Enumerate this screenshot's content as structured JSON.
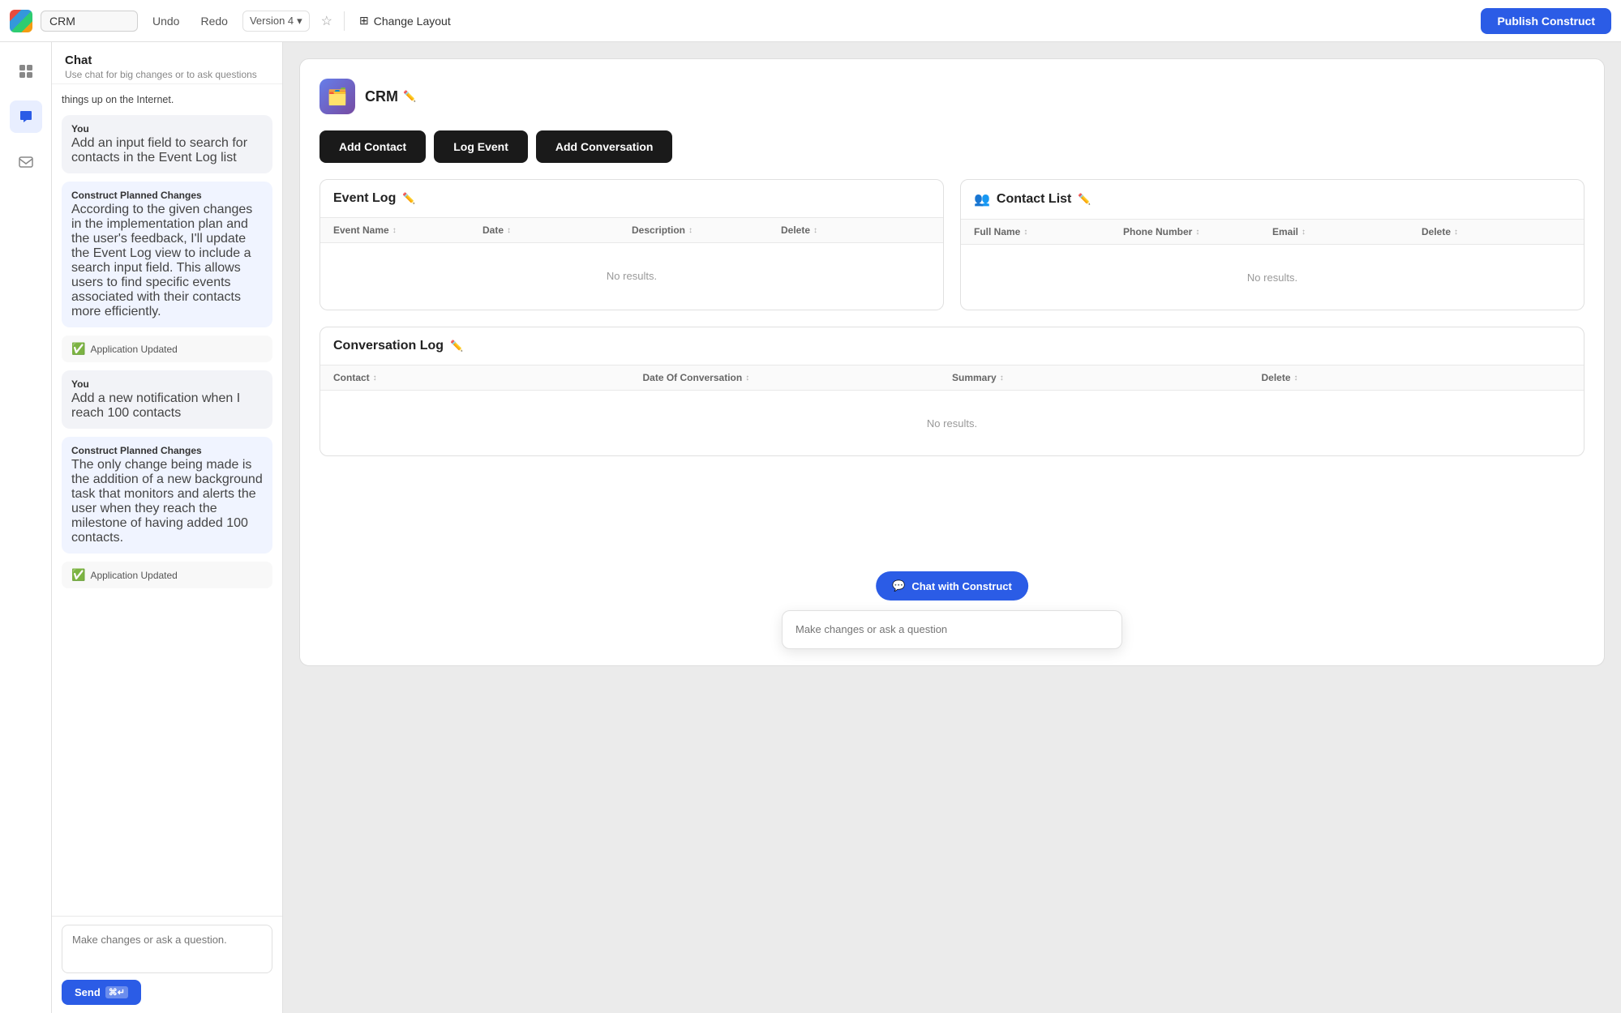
{
  "topbar": {
    "logo_alt": "App Logo",
    "app_name": "CRM",
    "undo_label": "Undo",
    "redo_label": "Redo",
    "version_label": "Version 4",
    "change_layout_label": "Change Layout",
    "publish_label": "Publish Construct"
  },
  "sidebar": {
    "items": [
      {
        "name": "grid-icon",
        "label": "Grid",
        "active": false
      },
      {
        "name": "chat-icon",
        "label": "Chat",
        "active": true
      },
      {
        "name": "mail-icon",
        "label": "Mail",
        "active": false
      }
    ]
  },
  "chat_panel": {
    "header_title": "Chat",
    "header_sub": "Use chat for big changes or to ask questions",
    "messages": [
      {
        "id": "msg1",
        "type": "system_text",
        "text": "things up on the Internet."
      },
      {
        "id": "msg2",
        "type": "user",
        "label": "You",
        "text": "Add an input field to search for contacts in the Event Log list"
      },
      {
        "id": "msg3",
        "type": "construct_planned",
        "label": "Construct Planned Changes",
        "text": "According to the given changes in the implementation plan and the user's feedback, I'll update the Event Log view to include a search input field. This allows users to find specific events associated with their contacts more efficiently."
      },
      {
        "id": "msg4",
        "type": "status",
        "text": "Application Updated"
      },
      {
        "id": "msg5",
        "type": "user",
        "label": "You",
        "text": "Add a new notification when I reach 100 contacts"
      },
      {
        "id": "msg6",
        "type": "construct_planned",
        "label": "Construct Planned Changes",
        "text": "The only change being made is the addition of a new background task that monitors and alerts the user when they reach the milestone of having added 100 contacts."
      },
      {
        "id": "msg7",
        "type": "status",
        "text": "Application Updated"
      }
    ],
    "input_placeholder": "Make changes or ask a question.",
    "send_label": "Send"
  },
  "app": {
    "icon_emoji": "🗂️",
    "title": "CRM",
    "buttons": [
      {
        "label": "Add Contact",
        "name": "add-contact-button"
      },
      {
        "label": "Log Event",
        "name": "log-event-button"
      },
      {
        "label": "Add Conversation",
        "name": "add-conversation-button"
      }
    ],
    "event_log": {
      "title": "Event Log",
      "columns": [
        "Event Name",
        "Date",
        "Description",
        "Delete"
      ],
      "no_results": "No results."
    },
    "contact_list": {
      "title": "Contact List",
      "icon": "👥",
      "columns": [
        "Full Name",
        "Phone Number",
        "Email",
        "Delete"
      ],
      "no_results": "No results."
    },
    "conversation_log": {
      "title": "Conversation Log",
      "columns": [
        "Contact",
        "Date Of Conversation",
        "Summary",
        "Delete"
      ],
      "no_results": "No results."
    }
  },
  "chat_float": {
    "button_label": "Chat with Construct",
    "input_placeholder": "Make changes or ask a question"
  }
}
